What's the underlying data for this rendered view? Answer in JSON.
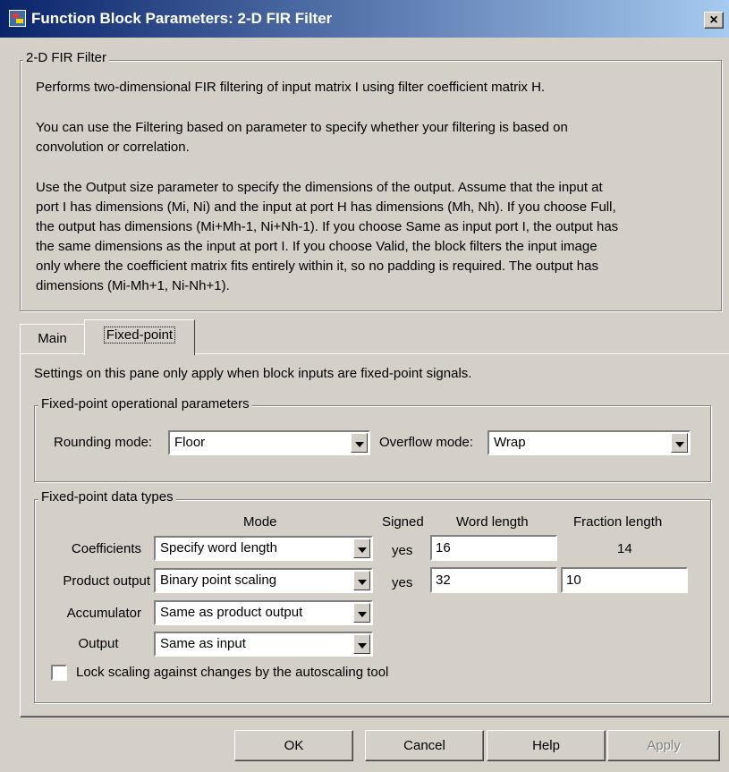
{
  "window": {
    "title": "Function Block Parameters: 2-D FIR Filter",
    "close_label": "×"
  },
  "description": {
    "group_label": "2-D FIR Filter",
    "lines": [
      "Performs two-dimensional FIR filtering of input matrix I using filter coefficient matrix H.",
      "You can use the Filtering based on parameter to specify whether your filtering is based on",
      "convolution or correlation.",
      "Use the Output size parameter to specify the dimensions of the output. Assume that the input at",
      "port I has dimensions (Mi, Ni) and the input at port H has dimensions (Mh, Nh). If you choose Full,",
      "the output has dimensions (Mi+Mh-1, Ni+Nh-1).  If you choose Same as input port I, the output has",
      "the same dimensions as the input at port I. If you choose Valid, the block filters the input image",
      "only where the coefficient matrix fits entirely within it, so no padding is required. The output has",
      "dimensions (Mi-Mh+1, Ni-Nh+1)."
    ]
  },
  "tabs": [
    {
      "label": "Main",
      "active": false
    },
    {
      "label": "Fixed-point",
      "active": true
    }
  ],
  "pane": {
    "note": "Settings on this pane only apply when block inputs are fixed-point signals.",
    "operational": {
      "group_label": "Fixed-point operational parameters",
      "rounding_label": "Rounding mode:",
      "rounding_value": "Floor",
      "overflow_label": "Overflow mode:",
      "overflow_value": "Wrap"
    },
    "datatypes": {
      "group_label": "Fixed-point data types",
      "headers": {
        "mode": "Mode",
        "signed": "Signed",
        "word": "Word length",
        "fraction": "Fraction length"
      },
      "rows": [
        {
          "label": "Coefficients",
          "mode": "Specify word length",
          "signed": "yes",
          "word": "16",
          "fraction": "14"
        },
        {
          "label": "Product output",
          "mode": "Binary point scaling",
          "signed": "yes",
          "word": "32",
          "fraction": "10"
        },
        {
          "label": "Accumulator",
          "mode": "Same as product output"
        },
        {
          "label": "Output",
          "mode": "Same as input"
        }
      ],
      "lock_label": "Lock scaling against changes by the autoscaling tool",
      "lock_checked": false
    }
  },
  "buttons": {
    "ok": "OK",
    "cancel": "Cancel",
    "help": "Help",
    "apply": "Apply"
  }
}
